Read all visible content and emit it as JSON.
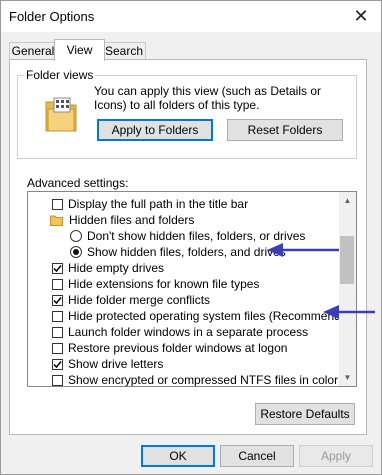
{
  "window": {
    "title": "Folder Options"
  },
  "tabs": [
    {
      "label": "General"
    },
    {
      "label": "View"
    },
    {
      "label": "Search"
    }
  ],
  "folder_views": {
    "legend": "Folder views",
    "description": "You can apply this view (such as Details or Icons) to all folders of this type.",
    "apply_button": "Apply to Folders",
    "reset_button": "Reset Folders"
  },
  "advanced": {
    "label": "Advanced settings:",
    "items": [
      {
        "label": "Display the full path in the title bar",
        "control": "checkbox",
        "checked": false
      },
      {
        "label": "Hidden files and folders",
        "control": "folder"
      },
      {
        "label": "Don't show hidden files, folders, or drives",
        "control": "radio",
        "checked": false
      },
      {
        "label": "Show hidden files, folders, and drives",
        "control": "radio",
        "checked": true
      },
      {
        "label": "Hide empty drives",
        "control": "checkbox",
        "checked": true
      },
      {
        "label": "Hide extensions for known file types",
        "control": "checkbox",
        "checked": false
      },
      {
        "label": "Hide folder merge conflicts",
        "control": "checkbox",
        "checked": true
      },
      {
        "label": "Hide protected operating system files (Recommended)",
        "control": "checkbox",
        "checked": false
      },
      {
        "label": "Launch folder windows in a separate process",
        "control": "checkbox",
        "checked": false
      },
      {
        "label": "Restore previous folder windows at logon",
        "control": "checkbox",
        "checked": false
      },
      {
        "label": "Show drive letters",
        "control": "checkbox",
        "checked": true
      },
      {
        "label": "Show encrypted or compressed NTFS files in color",
        "control": "checkbox",
        "checked": false
      }
    ]
  },
  "restore_defaults_button": "Restore Defaults",
  "footer": {
    "ok": "OK",
    "cancel": "Cancel",
    "apply": "Apply"
  },
  "colors": {
    "annotation_arrow": "#3b3fb5",
    "default_button_border": "#0078d7"
  }
}
